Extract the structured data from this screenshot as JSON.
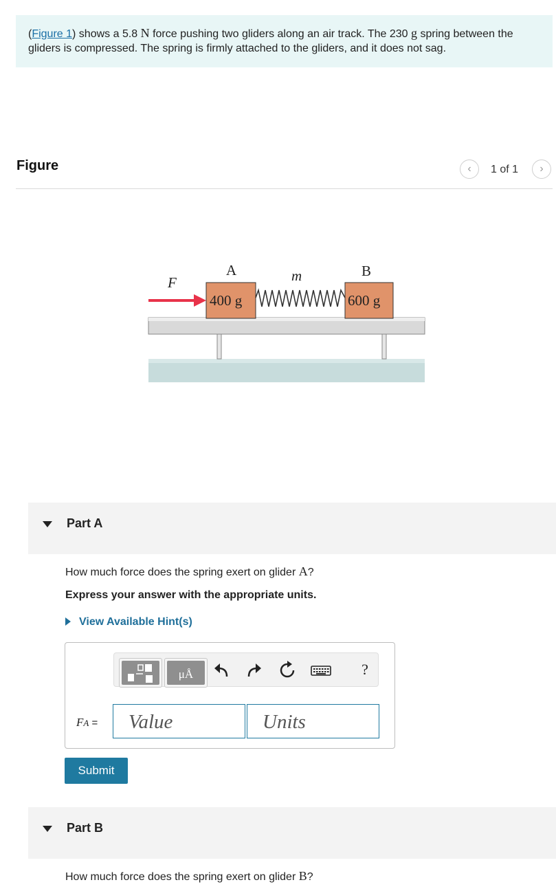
{
  "intro": {
    "figure_link": "Figure 1",
    "text_1": " shows a 5.8 ",
    "unit_N": "N",
    "text_2": " force pushing two gliders along an air track. The 230 ",
    "unit_g": "g",
    "text_3": " spring between the gliders is compressed. The spring is firmly attached to the gliders, and it does not sag."
  },
  "figure_panel": {
    "title": "Figure",
    "page_count": "1 of 1",
    "labels": {
      "force": "F",
      "glider_a": "A",
      "spring_mass": "m",
      "glider_b": "B",
      "mass_a": "400 g",
      "mass_b": "600 g"
    },
    "colors": {
      "glider": "#e0936a",
      "arrow": "#e8334a",
      "track": "#d9d9d9",
      "ground": "#c7dcdc"
    }
  },
  "part_a": {
    "label": "Part A",
    "question_pre": "How much force does the spring exert on glider ",
    "glider_var": "A",
    "question_post": "?",
    "instruction": "Express your answer with the appropriate units.",
    "hint_link": "View Available Hint(s)",
    "answer": {
      "symbol": "F",
      "subscript": "A",
      "equals": "=",
      "value_placeholder": "Value",
      "units_placeholder": "Units"
    },
    "toolbar": {
      "units_tile": "μÅ",
      "help": "?"
    },
    "submit_label": "Submit"
  },
  "part_b": {
    "label": "Part B",
    "question_pre": "How much force does the spring exert on glider ",
    "glider_var": "B",
    "question_post": "?"
  }
}
